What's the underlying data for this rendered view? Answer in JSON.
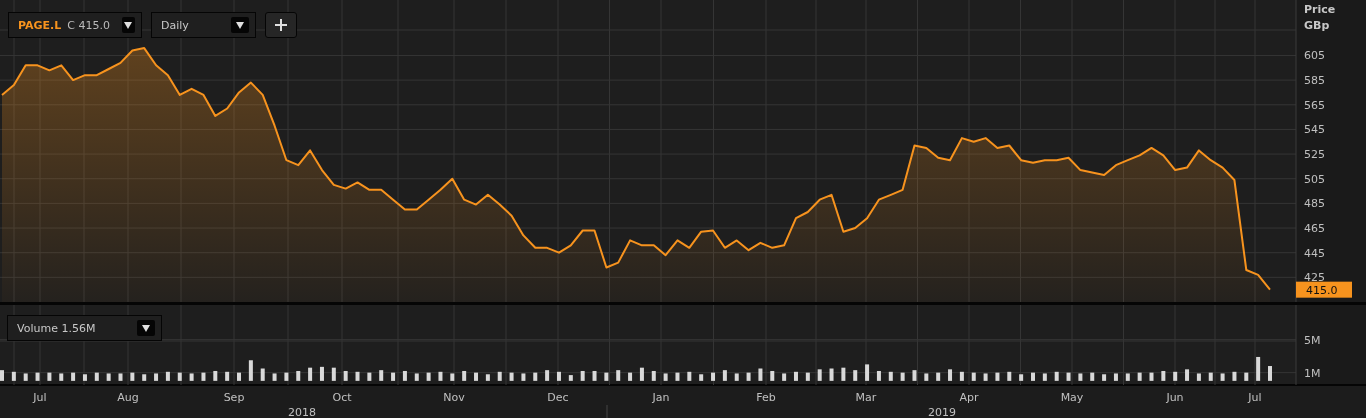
{
  "symbol_selector": {
    "ticker": "PAGE.L",
    "close_label": "C",
    "close_value": "415.0"
  },
  "interval_selector": {
    "value": "Daily"
  },
  "price_chart": {
    "axis_title": [
      "Price",
      "GBp"
    ],
    "last_price_label": "415.0",
    "chart_data": {
      "type": "area",
      "grid": true,
      "ylim": [
        405,
        650
      ],
      "yticks": [
        425,
        445,
        465,
        485,
        505,
        525,
        545,
        565,
        585,
        605
      ],
      "series": [
        {
          "color": "#f7931e",
          "values": [
            573,
            581,
            597,
            597,
            593,
            597,
            585,
            589,
            589,
            594,
            599,
            609,
            611,
            597,
            589,
            573,
            578,
            573,
            556,
            562,
            575,
            583,
            573,
            548,
            520,
            516,
            528,
            512,
            500,
            497,
            502,
            496,
            496,
            488,
            480,
            480,
            488,
            496,
            505,
            488,
            484,
            492,
            484,
            475,
            459,
            449,
            449,
            445,
            451,
            463,
            463,
            433,
            437,
            455,
            451,
            451,
            443,
            455,
            449,
            462,
            463,
            449,
            455,
            447,
            453,
            449,
            451,
            473,
            478,
            488,
            492,
            462,
            465,
            473,
            488,
            492,
            496,
            532,
            530,
            522,
            520,
            538,
            535,
            538,
            530,
            532,
            520,
            518,
            520,
            520,
            522,
            512,
            510,
            508,
            516,
            520,
            524,
            530,
            524,
            512,
            514,
            528,
            520,
            514,
            504,
            431,
            427,
            415
          ]
        }
      ]
    }
  },
  "volume_chart": {
    "selector": {
      "label": "Volume",
      "value": "1.56M"
    },
    "chart_data": {
      "type": "bar",
      "grid": true,
      "ylim": [
        -0.5,
        9.2
      ],
      "yticks": [
        {
          "value": 1,
          "label": "1M"
        },
        {
          "value": 5,
          "label": "5M"
        }
      ],
      "series": [
        {
          "color": "#d9d9d9",
          "values": [
            1.3,
            1.1,
            0.9,
            1.0,
            1.0,
            0.9,
            1.0,
            0.8,
            1.0,
            0.9,
            0.9,
            1.0,
            0.8,
            0.9,
            1.1,
            1.0,
            0.9,
            1.0,
            1.2,
            1.1,
            1.0,
            2.5,
            1.5,
            0.9,
            1.0,
            1.2,
            1.6,
            1.7,
            1.6,
            1.2,
            1.1,
            1.0,
            1.3,
            1.0,
            1.2,
            0.9,
            1.0,
            1.1,
            0.9,
            1.2,
            1.0,
            0.8,
            1.1,
            1.0,
            0.9,
            1.0,
            1.3,
            1.1,
            0.7,
            1.2,
            1.2,
            1.0,
            1.3,
            1.0,
            1.6,
            1.2,
            0.9,
            1.0,
            1.1,
            0.8,
            1.0,
            1.3,
            0.9,
            1.0,
            1.5,
            1.2,
            0.9,
            1.1,
            1.0,
            1.4,
            1.5,
            1.6,
            1.3,
            2.0,
            1.2,
            1.1,
            1.0,
            1.3,
            0.9,
            1.0,
            1.4,
            1.1,
            1.0,
            0.9,
            1.0,
            1.1,
            0.8,
            1.0,
            0.9,
            1.1,
            1.0,
            0.9,
            1.0,
            0.8,
            0.9,
            0.9,
            1.0,
            1.0,
            1.2,
            1.1,
            1.4,
            0.9,
            1.0,
            0.9,
            1.1,
            1.0,
            2.9,
            1.8
          ]
        }
      ]
    }
  },
  "time_axis": {
    "months": [
      "Jul",
      "Aug",
      "Sep",
      "Oct",
      "Nov",
      "Dec",
      "Jan",
      "Feb",
      "Mar",
      "Apr",
      "May",
      "Jun",
      "Jul"
    ],
    "years": [
      "2018",
      "2019"
    ]
  }
}
